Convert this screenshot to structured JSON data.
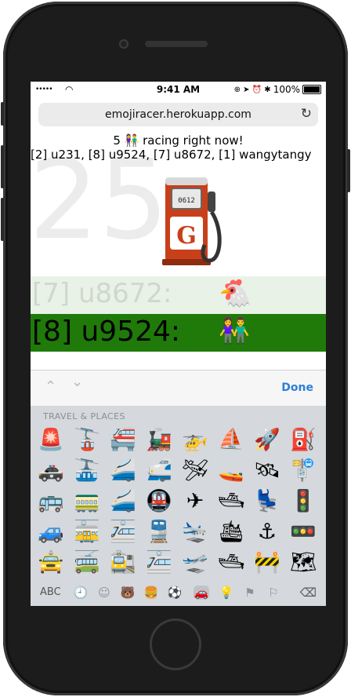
{
  "status_bar": {
    "signal": "•••••",
    "wifi": "wifi-icon",
    "time": "9:41 AM",
    "right_icons": "⊕ ➤ ⏰ ✱",
    "battery_percent": "100%"
  },
  "browser": {
    "url": "emojiracer.herokuapp.com",
    "reload_icon": "↻"
  },
  "game": {
    "countdown": "25",
    "headline": "5 👫 racing right now!",
    "racers_line": "[2] u231, [8] u9524, [7] u8672, [1] wangytangy",
    "current_emoji_name": "fuel-pump",
    "rows": [
      {
        "label": "[7] u8672:",
        "emoji": "🐔",
        "state": "faded"
      },
      {
        "label": "[8] u9524:",
        "emoji": "👫",
        "state": "active"
      }
    ],
    "colors": {
      "active_row": "#1f7a0a",
      "faded_row": "#e9f2e6"
    }
  },
  "accessory": {
    "up_arrow": "⌃",
    "down_arrow": "⌄",
    "done_label": "Done"
  },
  "keyboard": {
    "category": "TRAVEL & PLACES",
    "emojis": [
      [
        "🚨",
        "🚡",
        "🚝",
        "🚂",
        "🚁",
        "⛵",
        "🚀",
        "⛽"
      ],
      [
        "🚓",
        "🚠",
        "🚄",
        "🚅",
        "🛩",
        "🚤",
        "🛰",
        "🚏"
      ],
      [
        "🚌",
        "🚃",
        "🚄",
        "🚇",
        "✈",
        "🛥",
        "💺",
        "🚦"
      ],
      [
        "🚙",
        "🚋",
        "🚈",
        "🚆",
        "🛬",
        "🛳",
        "⚓",
        "🚥"
      ],
      [
        "🚖",
        "🚎",
        "🚉",
        "🚈",
        "🛫",
        "🛥",
        "🚧",
        "🗺"
      ]
    ],
    "abc_label": "ABC",
    "categories": [
      "🕘",
      "☺",
      "🐻",
      "🍔",
      "⚽",
      "🚗",
      "💡",
      "⚑",
      "⚐"
    ],
    "selected_category": 5,
    "backspace": "⌫"
  }
}
